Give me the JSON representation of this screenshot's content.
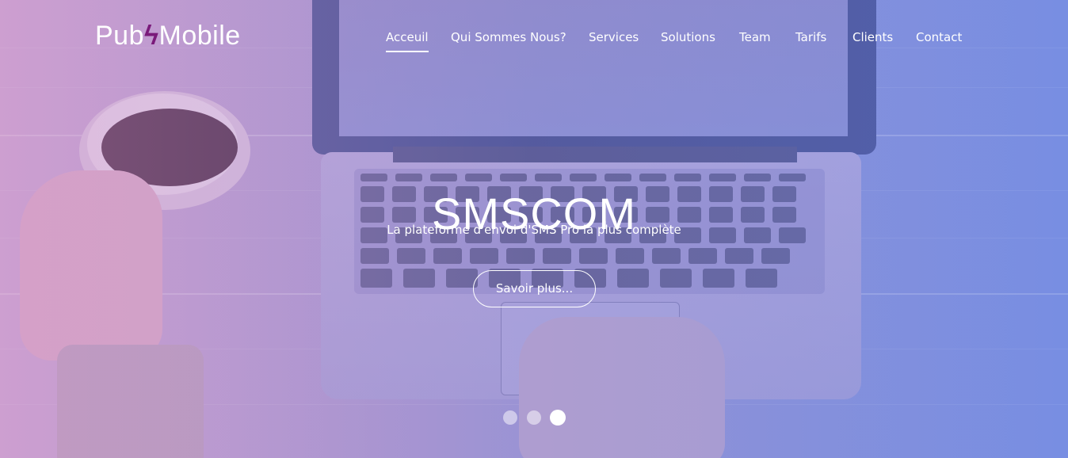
{
  "brand": {
    "logo_left": "Pub",
    "logo_bolt": "ϟ",
    "logo_right": "Mobile"
  },
  "nav": {
    "items": [
      {
        "label": "Acceuil",
        "active": true
      },
      {
        "label": "Qui Sommes Nous?",
        "active": false
      },
      {
        "label": "Services",
        "active": false
      },
      {
        "label": "Solutions",
        "active": false
      },
      {
        "label": "Team",
        "active": false
      },
      {
        "label": "Tarifs",
        "active": false
      },
      {
        "label": "Clients",
        "active": false
      },
      {
        "label": "Contact",
        "active": false
      }
    ]
  },
  "hero": {
    "title": "SMSCOM",
    "subtitle": "La plateforme d'envoi d'SMS Pro la plus complète",
    "button_label": "Savoir plus..."
  },
  "carousel": {
    "slide_count": 3,
    "active_index": 2
  },
  "colors": {
    "accent": "#7a1a7a",
    "text": "#ffffff",
    "gradient_left": "#c9a6d6",
    "gradient_right": "#7d8fe0"
  }
}
